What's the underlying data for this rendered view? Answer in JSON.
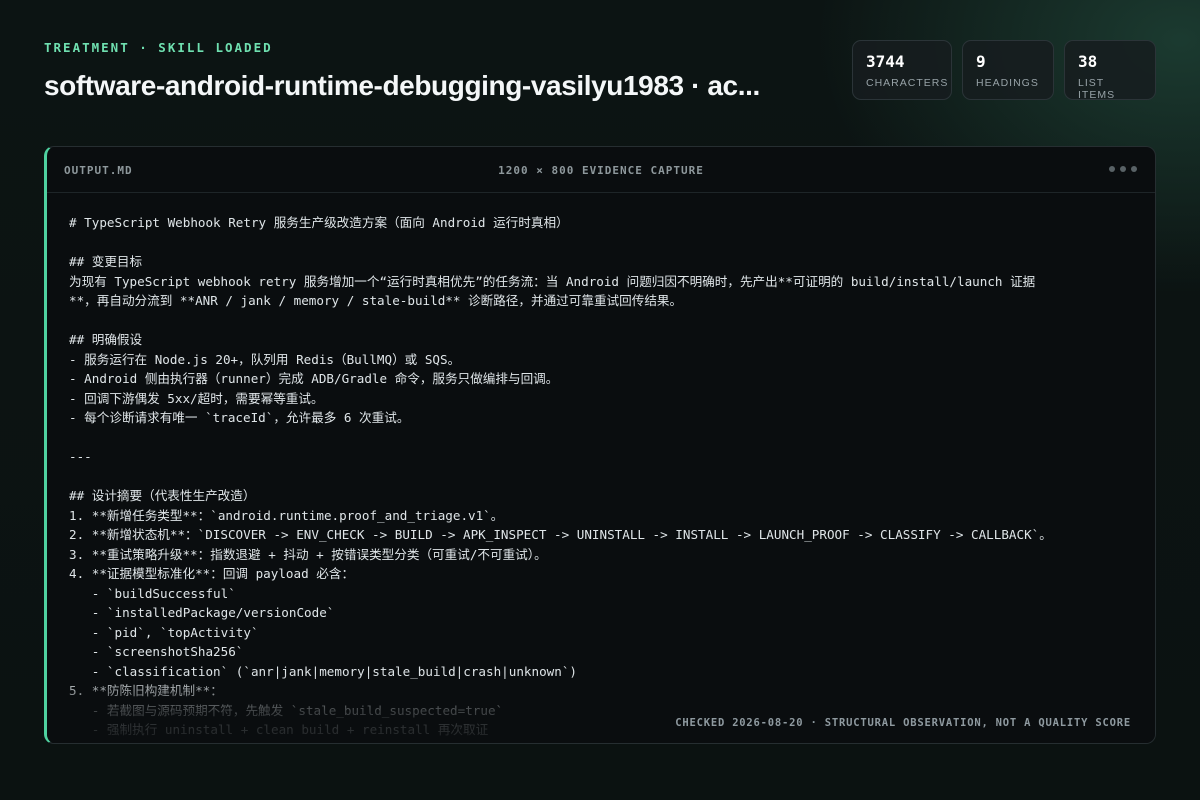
{
  "header": {
    "eyebrow": "TREATMENT · SKILL LOADED",
    "title": "software-android-runtime-debugging-vasilyu1983 · ac..."
  },
  "stats": [
    {
      "value": "3744",
      "label": "CHARACTERS"
    },
    {
      "value": "9",
      "label": "HEADINGS"
    },
    {
      "value": "38",
      "label": "LIST ITEMS"
    }
  ],
  "panel": {
    "filename": "OUTPUT.MD",
    "caption": "1200 × 800 EVIDENCE CAPTURE",
    "footnote": "CHECKED 2026-08-20 · STRUCTURAL OBSERVATION, NOT A QUALITY SCORE",
    "lines": [
      "# TypeScript Webhook Retry 服务生产级改造方案（面向 Android 运行时真相）",
      "",
      "## 变更目标",
      "为现有 TypeScript webhook retry 服务增加一个“运行时真相优先”的任务流：当 Android 问题归因不明确时，先产出**可证明的 build/install/launch 证据",
      "**，再自动分流到 **ANR / jank / memory / stale-build** 诊断路径，并通过可靠重试回传结果。",
      "",
      "## 明确假设",
      "- 服务运行在 Node.js 20+，队列用 Redis（BullMQ）或 SQS。",
      "- Android 侧由执行器（runner）完成 ADB/Gradle 命令，服务只做编排与回调。",
      "- 回调下游偶发 5xx/超时，需要幂等重试。",
      "- 每个诊断请求有唯一 `traceId`，允许最多 6 次重试。",
      "",
      "---",
      "",
      "## 设计摘要（代表性生产改造）",
      "1. **新增任务类型**：`android.runtime.proof_and_triage.v1`。",
      "2. **新增状态机**：`DISCOVER -> ENV_CHECK -> BUILD -> APK_INSPECT -> UNINSTALL -> INSTALL -> LAUNCH_PROOF -> CLASSIFY -> CALLBACK`。",
      "3. **重试策略升级**：指数退避 + 抖动 + 按错误类型分类（可重试/不可重试）。",
      "4. **证据模型标准化**：回调 payload 必含：",
      "   - `buildSuccessful`",
      "   - `installedPackage/versionCode`",
      "   - `pid`, `topActivity`",
      "   - `screenshotSha256`",
      "   - `classification` (`anr|jank|memory|stale_build|crash|unknown`)",
      "5. **防陈旧构建机制**：",
      "   - 若截图与源码预期不符，先触发 `stale_build_suspected=true`",
      "   - 强制执行 uninstall + clean build + reinstall 再次取证"
    ]
  }
}
